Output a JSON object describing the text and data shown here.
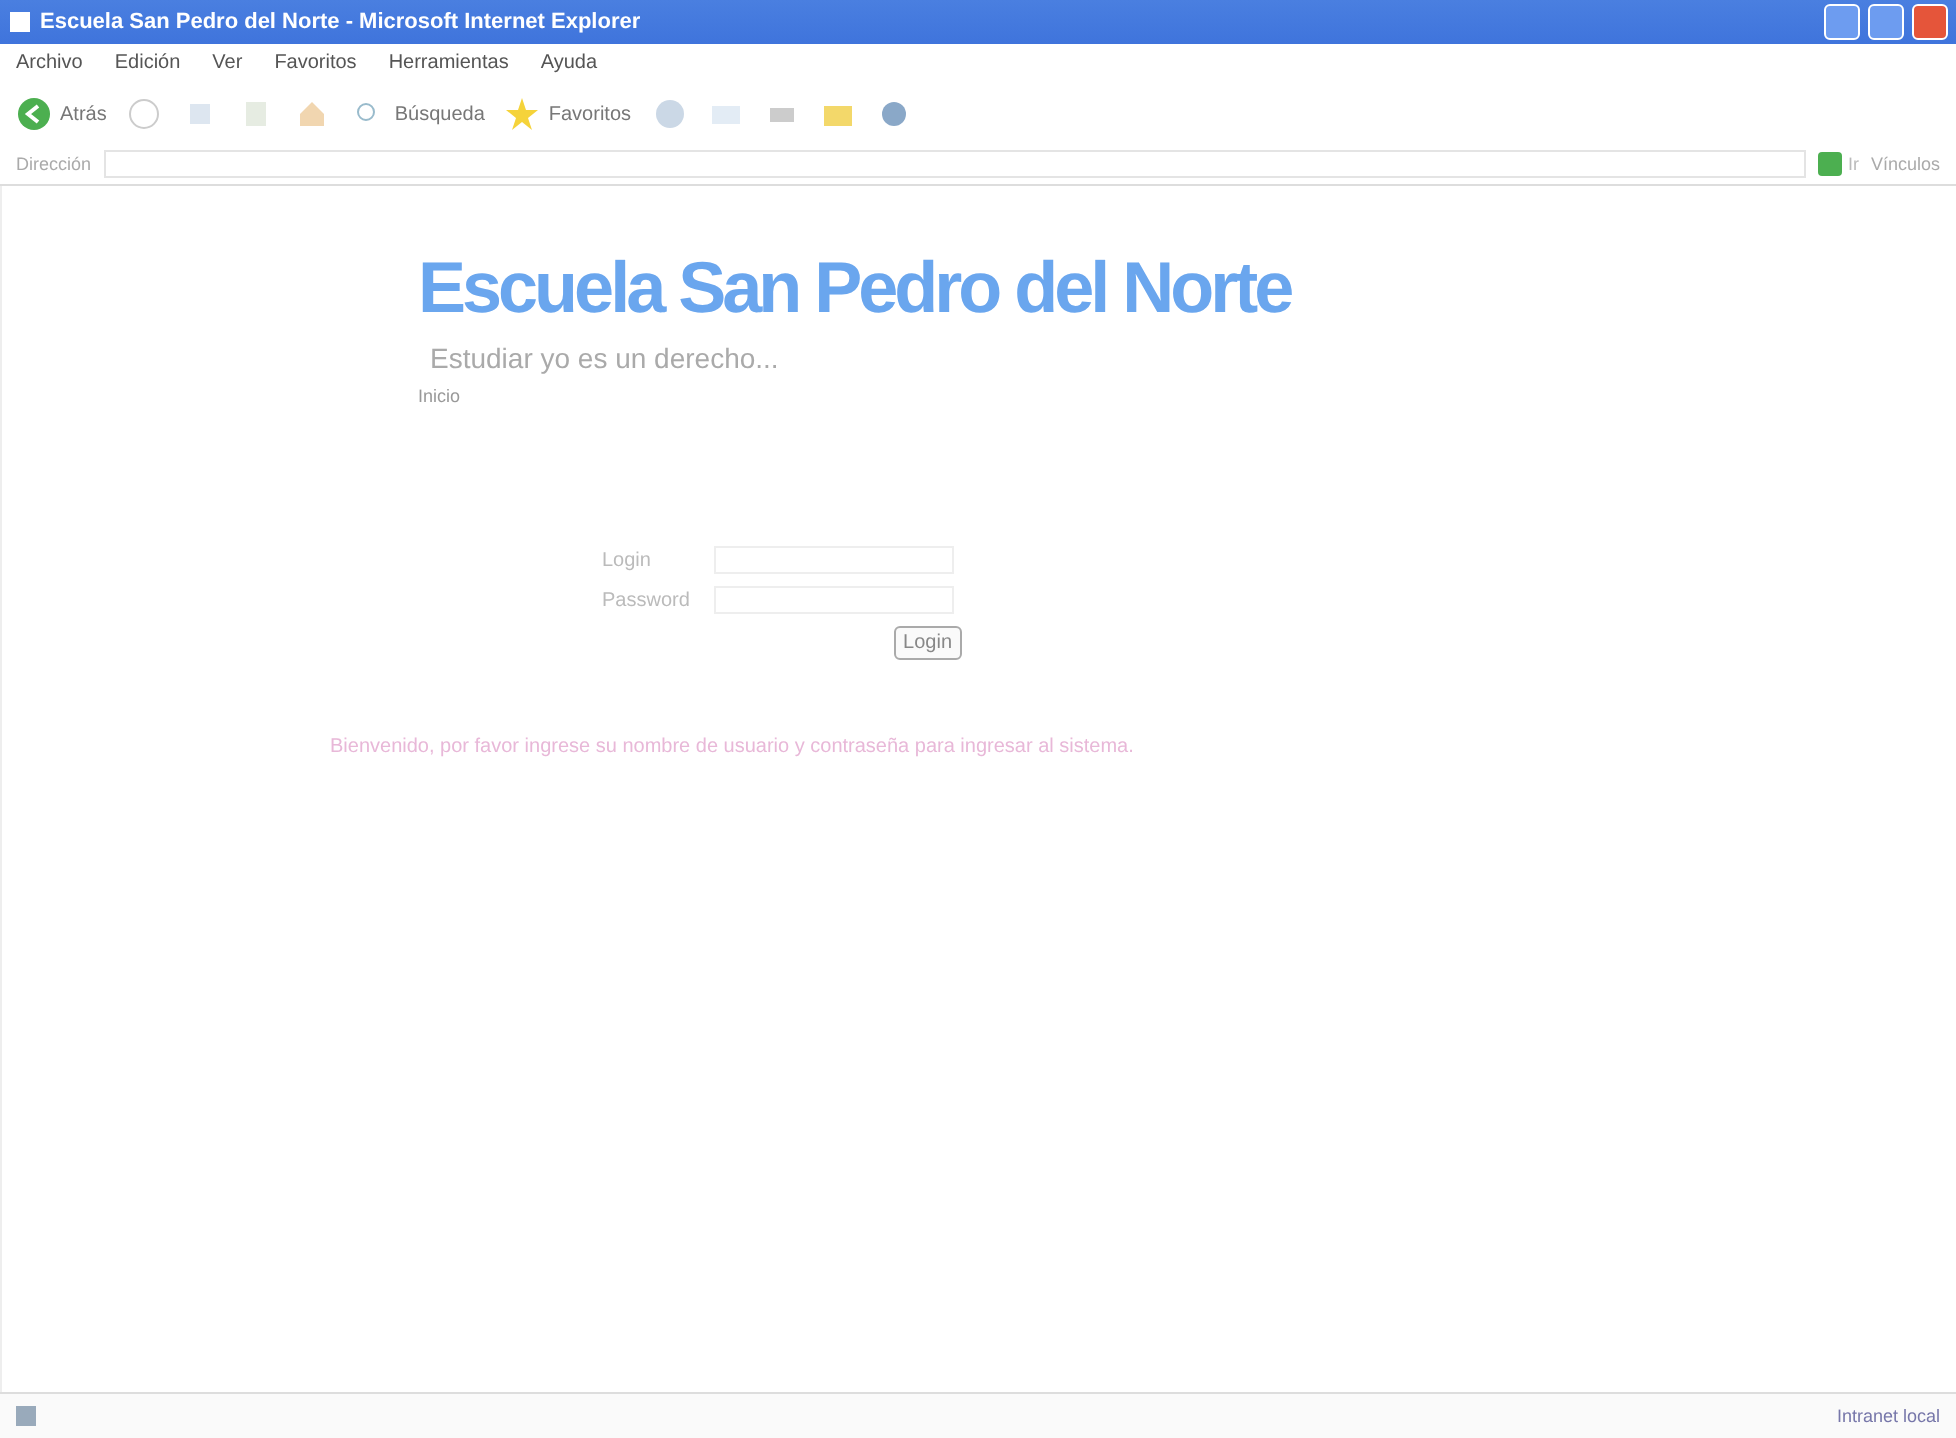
{
  "window": {
    "title": "Escuela San Pedro del Norte - Microsoft Internet Explorer"
  },
  "menu": [
    "Archivo",
    "Edición",
    "Ver",
    "Favoritos",
    "Herramientas",
    "Ayuda"
  ],
  "toolbar": {
    "back": "Atrás",
    "search": "Búsqueda",
    "favorites": "Favoritos"
  },
  "address_bar": {
    "label": "Dirección",
    "go": "Ir",
    "links": "Vínculos"
  },
  "page": {
    "heading": "Escuela San Pedro del Norte",
    "tagline": "Estudiar yo es un derecho...",
    "nav": "Inicio",
    "login": {
      "user_label": "Login",
      "password_label": "Password",
      "button": "Login"
    },
    "message": "Bienvenido, por favor ingrese su nombre de usuario y contraseña para ingresar al sistema."
  },
  "status_bar": {
    "zone": "Intranet local"
  }
}
